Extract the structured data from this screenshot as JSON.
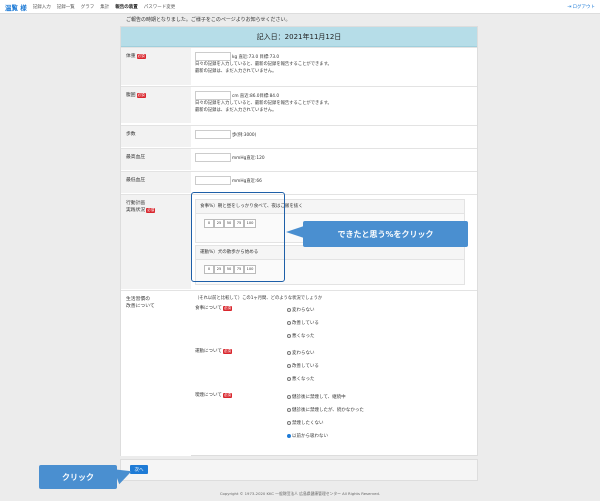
{
  "navbar": {
    "brand": "温覧 様",
    "links": [
      "記録入力",
      "記録一覧",
      "グラフ",
      "集計",
      "報告の装置",
      "パスワード変更"
    ],
    "logout": "ログアウト"
  },
  "notice": "ご報告の時期となりました。ご様子をこのページよりお知らせください。",
  "header": {
    "date_title": "記入日：2021年11月12日"
  },
  "required_badge": "必須",
  "weight": {
    "label": "体重",
    "unit": "kg 直近:73.0 目標:73.0",
    "hint1": "日々の記録を入力していると、最新の記録を報告することができます。",
    "hint2": "最新の記録は、まだ入力されていません。"
  },
  "waist": {
    "label": "腹囲",
    "unit": "cm 直近:86.0目標:84.0",
    "hint1": "日々の記録を入力していると、最新の記録を報告することができます。",
    "hint2": "最新の記録は、まだ入力されていません。"
  },
  "steps": {
    "label": "歩数",
    "unit": "歩(例:3000)"
  },
  "bp_high": {
    "label": "最高血圧",
    "unit": "mmHg直近:120"
  },
  "bp_low": {
    "label": "最低血圧",
    "unit": "mmHg直近:66"
  },
  "action_plan": {
    "label1": "行動計画",
    "label2": "実践状況",
    "meal_title": "食事%）朝と昼をしっかり食べて、夜はご飯を抜く",
    "exercise_title": "運動%）犬の散歩から始める",
    "percents": [
      "0",
      "25",
      "50",
      "75",
      "100"
    ]
  },
  "callout_click_pct": "できたと思う%をクリック",
  "habits": {
    "label1": "生活習慣の",
    "label2": "改善について",
    "question": "（それ以前と比較して）この1ヶ月間、どのような状況でしょうか",
    "meal_label": "食事について",
    "meal_options": [
      "変わらない",
      "改善している",
      "悪くなった"
    ],
    "exercise_label": "運動について",
    "exercise_options": [
      "変わらない",
      "改善している",
      "悪くなった"
    ],
    "smoking_label": "喫煙について",
    "smoking_options": [
      "健診後に禁煙して、継続中",
      "健診後に禁煙したが、続かなかった",
      "禁煙したくない",
      "以前から吸わない"
    ]
  },
  "next_button": "次へ",
  "callout_click": "クリック",
  "copyright": "Copyright © 1973-2020 KKC 一般財団法人 広島県健康管理センター All Rights Reserved."
}
